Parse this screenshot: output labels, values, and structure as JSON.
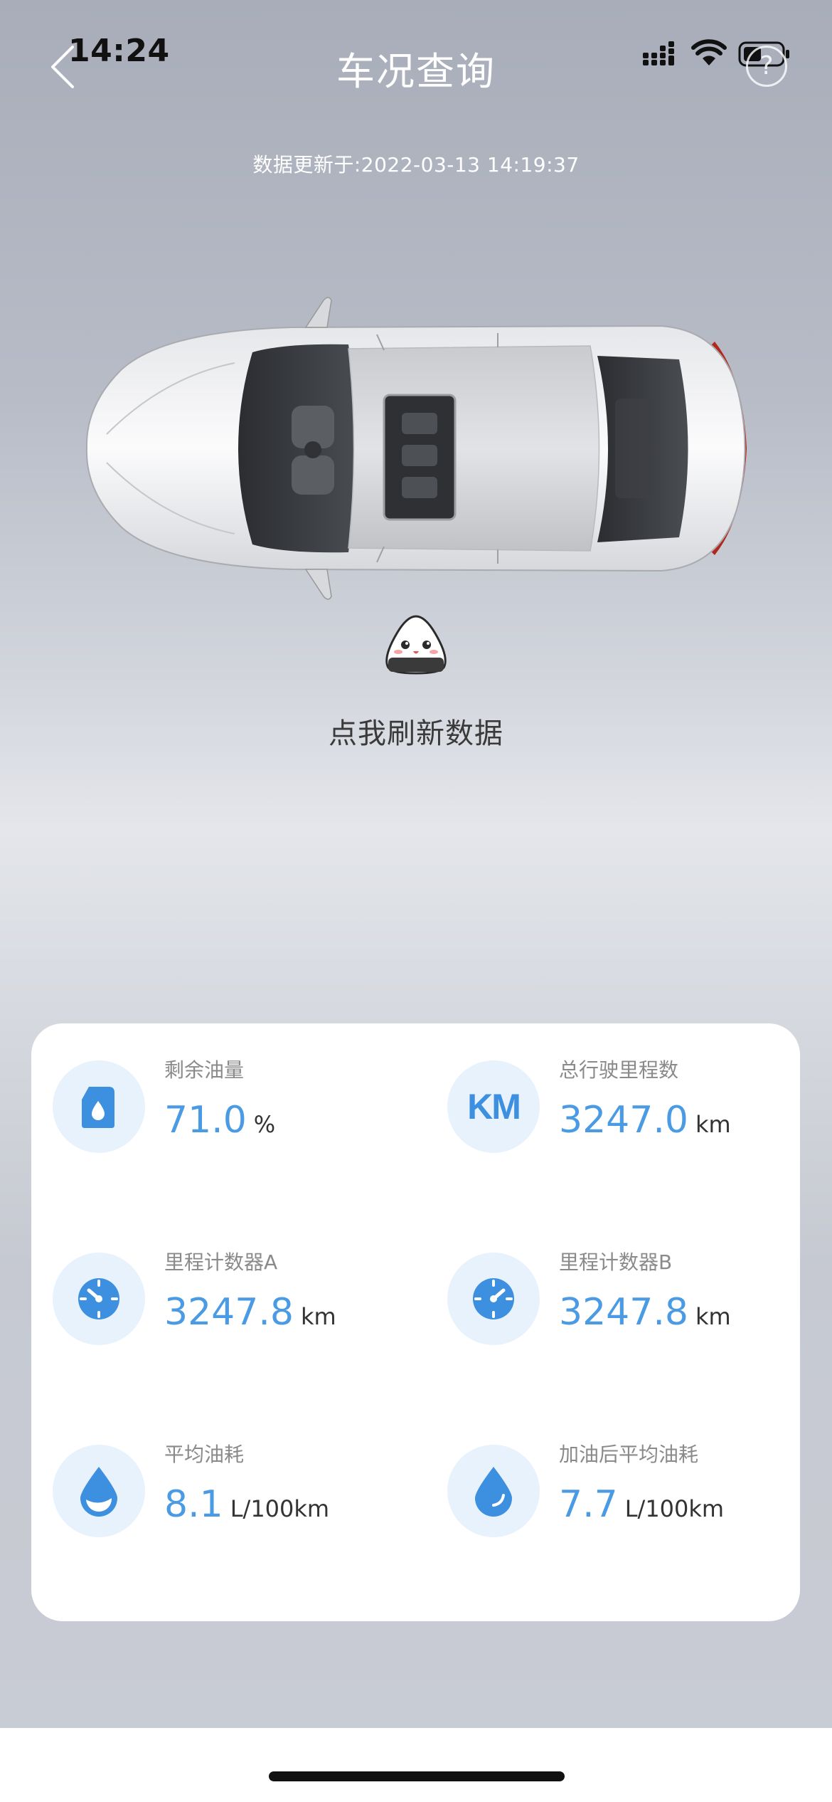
{
  "status_bar": {
    "time": "14:24"
  },
  "nav": {
    "title": "车况查询"
  },
  "update": {
    "text": "数据更新于:2022-03-13 14:19:37"
  },
  "refresh": {
    "label": "点我刷新数据"
  },
  "stats": [
    {
      "label": "剩余油量",
      "value": "71.0",
      "unit": "%",
      "icon": "fuel-can-icon"
    },
    {
      "label": "总行驶里程数",
      "value": "3247.0",
      "unit": "km",
      "icon": "km-icon",
      "icon_text": "KM"
    },
    {
      "label": "里程计数器A",
      "value": "3247.8",
      "unit": "km",
      "icon": "speedometer-icon"
    },
    {
      "label": "里程计数器B",
      "value": "3247.8",
      "unit": "km",
      "icon": "speedometer-icon"
    },
    {
      "label": "平均油耗",
      "value": "8.1",
      "unit": "L/100km",
      "icon": "drop-icon"
    },
    {
      "label": "加油后平均油耗",
      "value": "7.7",
      "unit": "L/100km",
      "icon": "drop-icon"
    }
  ],
  "colors": {
    "accent": "#4a9be3",
    "icon_bg": "#e8f2fc",
    "card": "#ffffff"
  }
}
